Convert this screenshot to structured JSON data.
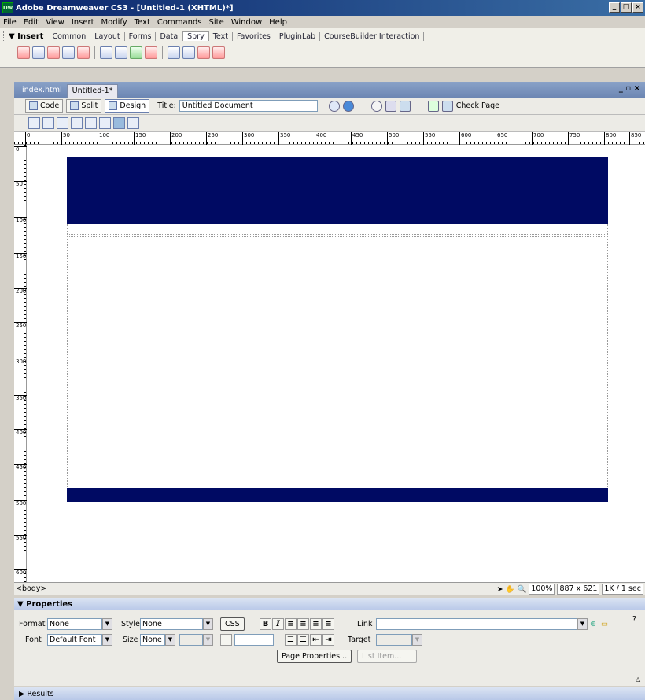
{
  "app": {
    "title": "Adobe Dreamweaver CS3 - [Untitled-1 (XHTML)*]",
    "logo": "Dw"
  },
  "menu": [
    "File",
    "Edit",
    "View",
    "Insert",
    "Modify",
    "Text",
    "Commands",
    "Site",
    "Window",
    "Help"
  ],
  "insert_bar": {
    "label": "▼ Insert",
    "tabs": [
      "Common",
      "Layout",
      "Forms",
      "Data",
      "Spry",
      "Text",
      "Favorites",
      "PluginLab",
      "CourseBuilder Interaction"
    ],
    "active_tab": "Spry"
  },
  "doc_tabs": [
    "index.html",
    "Untitled-1*"
  ],
  "doc_toolbar": {
    "code": "Code",
    "split": "Split",
    "design": "Design",
    "title_label": "Title:",
    "title_value": "Untitled Document",
    "check_page": "Check Page"
  },
  "ruler": {
    "h": [
      "0",
      "50",
      "100",
      "150",
      "200",
      "250",
      "300",
      "350",
      "400",
      "450",
      "500",
      "550",
      "600",
      "650",
      "700",
      "750",
      "800",
      "850"
    ],
    "v": [
      "0",
      "50",
      "100",
      "150",
      "200",
      "250",
      "300",
      "350",
      "400",
      "450",
      "500",
      "550",
      "600"
    ]
  },
  "statusbar": {
    "tag": "<body>",
    "zoom": "100%",
    "size": "887 x 621",
    "download": "1K / 1 sec"
  },
  "properties": {
    "header": "▼ Properties",
    "format_label": "Format",
    "format_value": "None",
    "style_label": "Style",
    "style_value": "None",
    "css_btn": "CSS",
    "bold": "B",
    "italic": "I",
    "link_label": "Link",
    "font_label": "Font",
    "font_value": "Default Font",
    "size_label": "Size",
    "size_value": "None",
    "target_label": "Target",
    "page_props_btn": "Page Properties...",
    "list_item_btn": "List Item..."
  },
  "results_label": "▶ Results",
  "colors": {
    "banner": "#000a63",
    "panel_header": "#b8c8e8"
  }
}
